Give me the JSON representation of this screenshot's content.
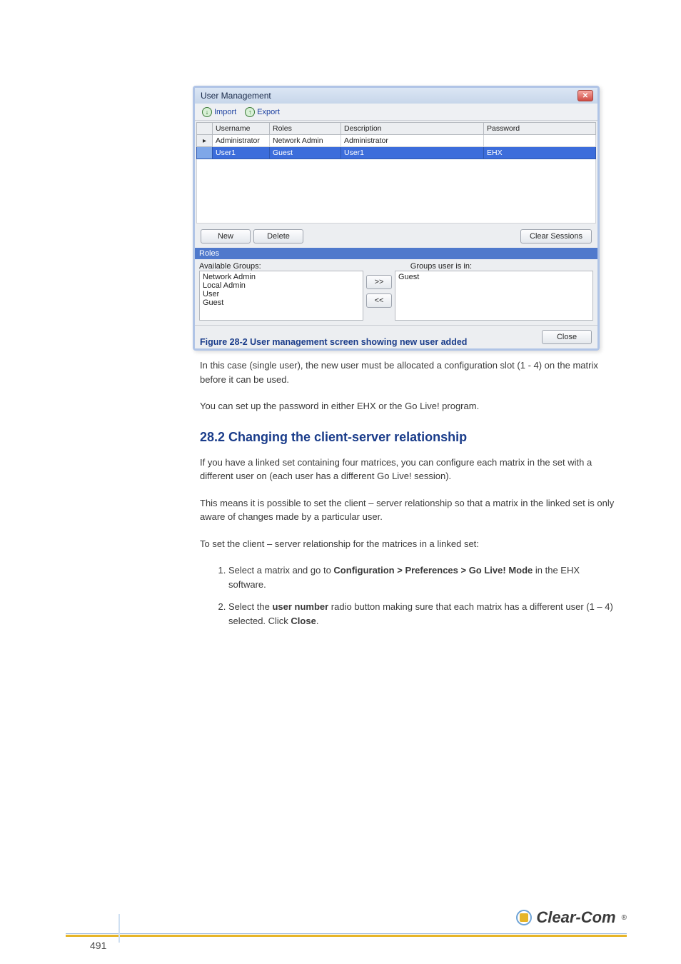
{
  "page": {
    "number": "491"
  },
  "brand": {
    "name": "Clear-Com",
    "reg": "®"
  },
  "caption": "Figure 28-2 User management screen showing new user added",
  "body": {
    "p1": "In this case (single user), the new user must be allocated a configuration slot (1 - 4) on the matrix before it can be used.",
    "p2": "You can set up the password in either EHX or the Go Live! program.",
    "h3": "28.2 Changing the client-server relationship",
    "p3": "If you have a linked set containing four matrices, you can configure each matrix in the set with a different user on (each user has a different Go Live! session).",
    "p4": "This means it is possible to set the client – server relationship so that a matrix in the linked set is only aware of changes made by a particular user.",
    "p5_lead": "To set the client – server relationship for the matrices in a linked set:",
    "li1": {
      "a": "Select a matrix and go to ",
      "b": "Configuration > Preferences > Go Live! Mode",
      "c": " in the EHX software."
    },
    "li2": {
      "a": "Select the ",
      "b": "user number",
      "c": " radio button making sure that each matrix has a different user (1 – 4) selected. Click ",
      "d": "Close",
      "e": "."
    }
  },
  "dialog": {
    "title": "User Management",
    "toolbar": {
      "import": "Import",
      "export": "Export"
    },
    "headers": {
      "selector": "",
      "username": "Username",
      "roles": "Roles",
      "description": "Description",
      "password": "Password"
    },
    "rows": [
      {
        "selected": false,
        "arrow": true,
        "username": "Administrator",
        "roles": "Network Admin",
        "description": "Administrator",
        "password": ""
      },
      {
        "selected": true,
        "arrow": false,
        "username": "User1",
        "roles": "Guest",
        "description": "User1",
        "password": "EHX"
      }
    ],
    "buttons": {
      "new": "New",
      "delete": "Delete",
      "clear_sessions": "Clear Sessions",
      "close": "Close"
    },
    "roles_section": {
      "header": "Roles",
      "available_label": "Available Groups:",
      "member_label": "Groups user is in:",
      "available_groups": [
        "Network Admin",
        "Local Admin",
        "User",
        "Guest"
      ],
      "member_groups": [
        "Guest"
      ],
      "move_right": ">>",
      "move_left": "<<"
    }
  }
}
